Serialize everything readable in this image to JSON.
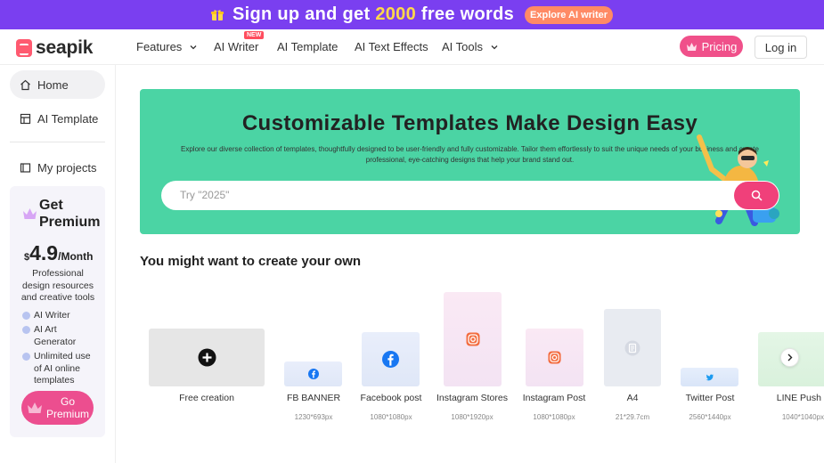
{
  "promo": {
    "lead": "Sign up and get ",
    "highlight": "2000",
    "tail": " free words",
    "button": "Explore AI writer",
    "gift_icon": "gift-icon"
  },
  "nav": {
    "brand": "seapik",
    "items": [
      {
        "label": "Features",
        "has_dropdown": true
      },
      {
        "label": "AI Writer",
        "badge": "NEW"
      },
      {
        "label": "AI Template"
      },
      {
        "label": "AI Text Effects"
      },
      {
        "label": "AI Tools",
        "has_dropdown": true
      }
    ],
    "pricing": "Pricing",
    "login": "Log in"
  },
  "sidebar": {
    "items": [
      {
        "label": "Home",
        "icon": "home-icon"
      },
      {
        "label": "AI Template",
        "icon": "template-icon"
      },
      {
        "label": "My projects",
        "icon": "folder-icon"
      }
    ],
    "premium": {
      "title_line1": "Get",
      "title_line2": "Premium",
      "currency": "$",
      "price": "4.9",
      "period": "/Month",
      "description": "Professional design resources and creative tools",
      "features": [
        "AI Writer",
        "AI Art Generator",
        "Unlimited use of AI online templates"
      ],
      "cta_line1": "Go",
      "cta_line2": "Premium"
    }
  },
  "hero": {
    "title": "Customizable Templates Make Design Easy",
    "subtitle": "Explore our diverse collection of templates, thoughtfully designed to be user-friendly and fully customizable. Tailor them effortlessly to suit the unique needs of your business and create professional, eye-catching designs that help your brand stand out.",
    "search_placeholder": "Try \"2025\"",
    "search_icon": "search-icon"
  },
  "section": {
    "title": "You might want to create your own"
  },
  "templates": [
    {
      "name": "Free creation",
      "size": "",
      "icon": "plus-icon"
    },
    {
      "name": "FB BANNER",
      "size": "1230*693px",
      "icon": "facebook-icon"
    },
    {
      "name": "Facebook post",
      "size": "1080*1080px",
      "icon": "facebook-icon"
    },
    {
      "name": "Instagram Stores",
      "size": "1080*1920px",
      "icon": "instagram-icon"
    },
    {
      "name": "Instagram Post",
      "size": "1080*1080px",
      "icon": "instagram-icon"
    },
    {
      "name": "A4",
      "size": "21*29.7cm",
      "icon": "document-icon"
    },
    {
      "name": "Twitter Post",
      "size": "2560*1440px",
      "icon": "twitter-icon"
    },
    {
      "name": "LINE Push",
      "size": "1040*1040px",
      "icon": "line-icon"
    }
  ],
  "colors": {
    "promo_bg": "#7a3ff0",
    "promo_highlight": "#ffd84a",
    "hero_bg": "#4bd4a4",
    "accent_pink": "#f0508a",
    "brand_red": "#ff5a70"
  }
}
